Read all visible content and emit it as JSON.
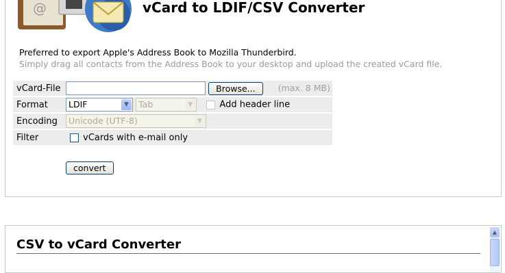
{
  "converter1": {
    "title": "vCard to LDIF/CSV Converter",
    "intro_line1": "Preferred to export Apple's Address Book to Mozilla Thunderbird.",
    "intro_line2": "Simply drag all contacts from the Address Book to your desktop and upload the created vCard file.",
    "rows": {
      "vcard_file_label": "vCard-File",
      "browse_label": "Browse...",
      "max_size": "(max. 8 MB)",
      "format_label": "Format",
      "format_value": "LDIF",
      "delimiter_value": "Tab",
      "header_line_label": "Add header line",
      "encoding_label": "Encoding",
      "encoding_value": "Unicode (UTF-8)",
      "filter_label": "Filter",
      "filter_option_label": "vCards with e-mail only"
    },
    "convert_label": "convert"
  },
  "converter2": {
    "title": "CSV to vCard Converter"
  },
  "icons": {
    "logo": "address-book-thunderbird-logo",
    "dropdown": "chevron-down-icon",
    "scroll_up": "scroll-up-arrow-icon"
  }
}
